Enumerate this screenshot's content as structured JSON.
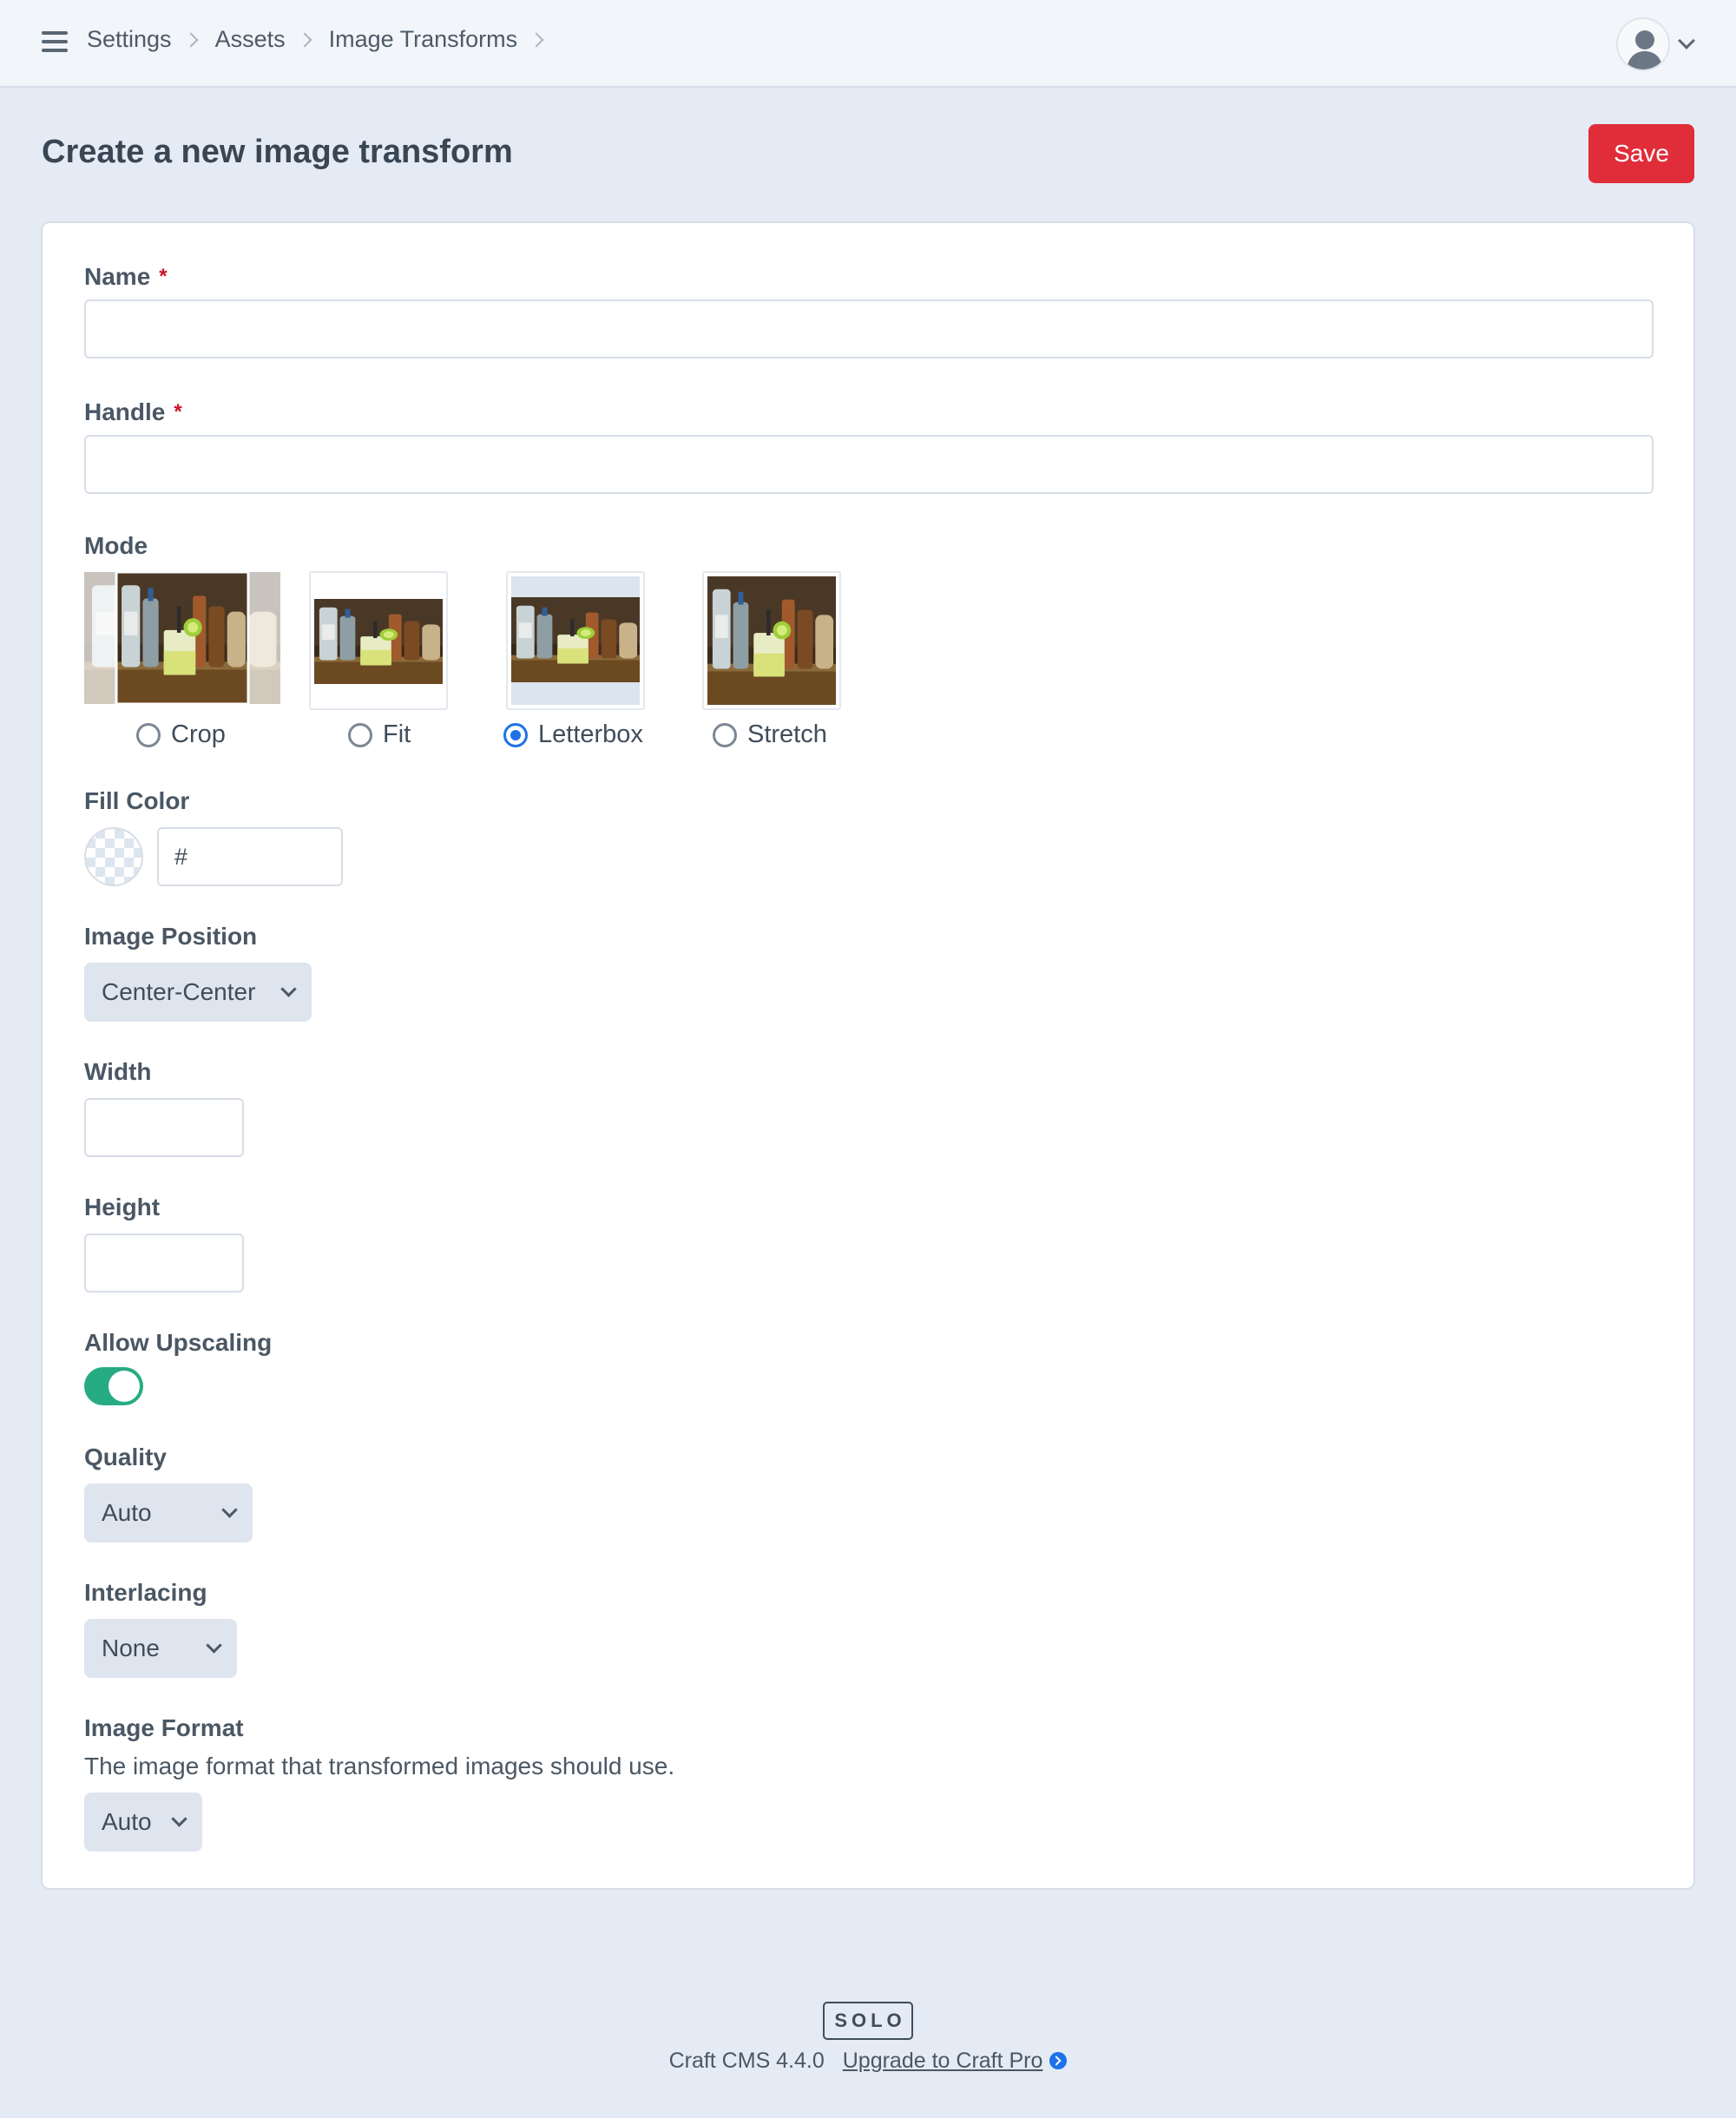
{
  "header": {
    "breadcrumbs": [
      "Settings",
      "Assets",
      "Image Transforms"
    ]
  },
  "page": {
    "title": "Create a new image transform",
    "save_label": "Save"
  },
  "form": {
    "name": {
      "label": "Name",
      "required_mark": "*",
      "value": ""
    },
    "handle": {
      "label": "Handle",
      "required_mark": "*",
      "value": ""
    },
    "mode": {
      "label": "Mode",
      "options": [
        "Crop",
        "Fit",
        "Letterbox",
        "Stretch"
      ],
      "selected": "Letterbox"
    },
    "fill_color": {
      "label": "Fill Color",
      "value": "#"
    },
    "image_position": {
      "label": "Image Position",
      "value": "Center-Center"
    },
    "width": {
      "label": "Width",
      "value": ""
    },
    "height": {
      "label": "Height",
      "value": ""
    },
    "allow_upscaling": {
      "label": "Allow Upscaling",
      "on": true
    },
    "quality": {
      "label": "Quality",
      "value": "Auto"
    },
    "interlacing": {
      "label": "Interlacing",
      "value": "None"
    },
    "image_format": {
      "label": "Image Format",
      "instructions": "The image format that transformed images should use.",
      "value": "Auto"
    }
  },
  "footer": {
    "edition": "SOLO",
    "version": "Craft CMS 4.4.0",
    "upgrade_label": "Upgrade to Craft Pro"
  },
  "colors": {
    "accent_red": "#e12d39",
    "toggle_on": "#27ab83",
    "radio_selected": "#1d72e8",
    "page_bg": "#e4ebf4"
  }
}
